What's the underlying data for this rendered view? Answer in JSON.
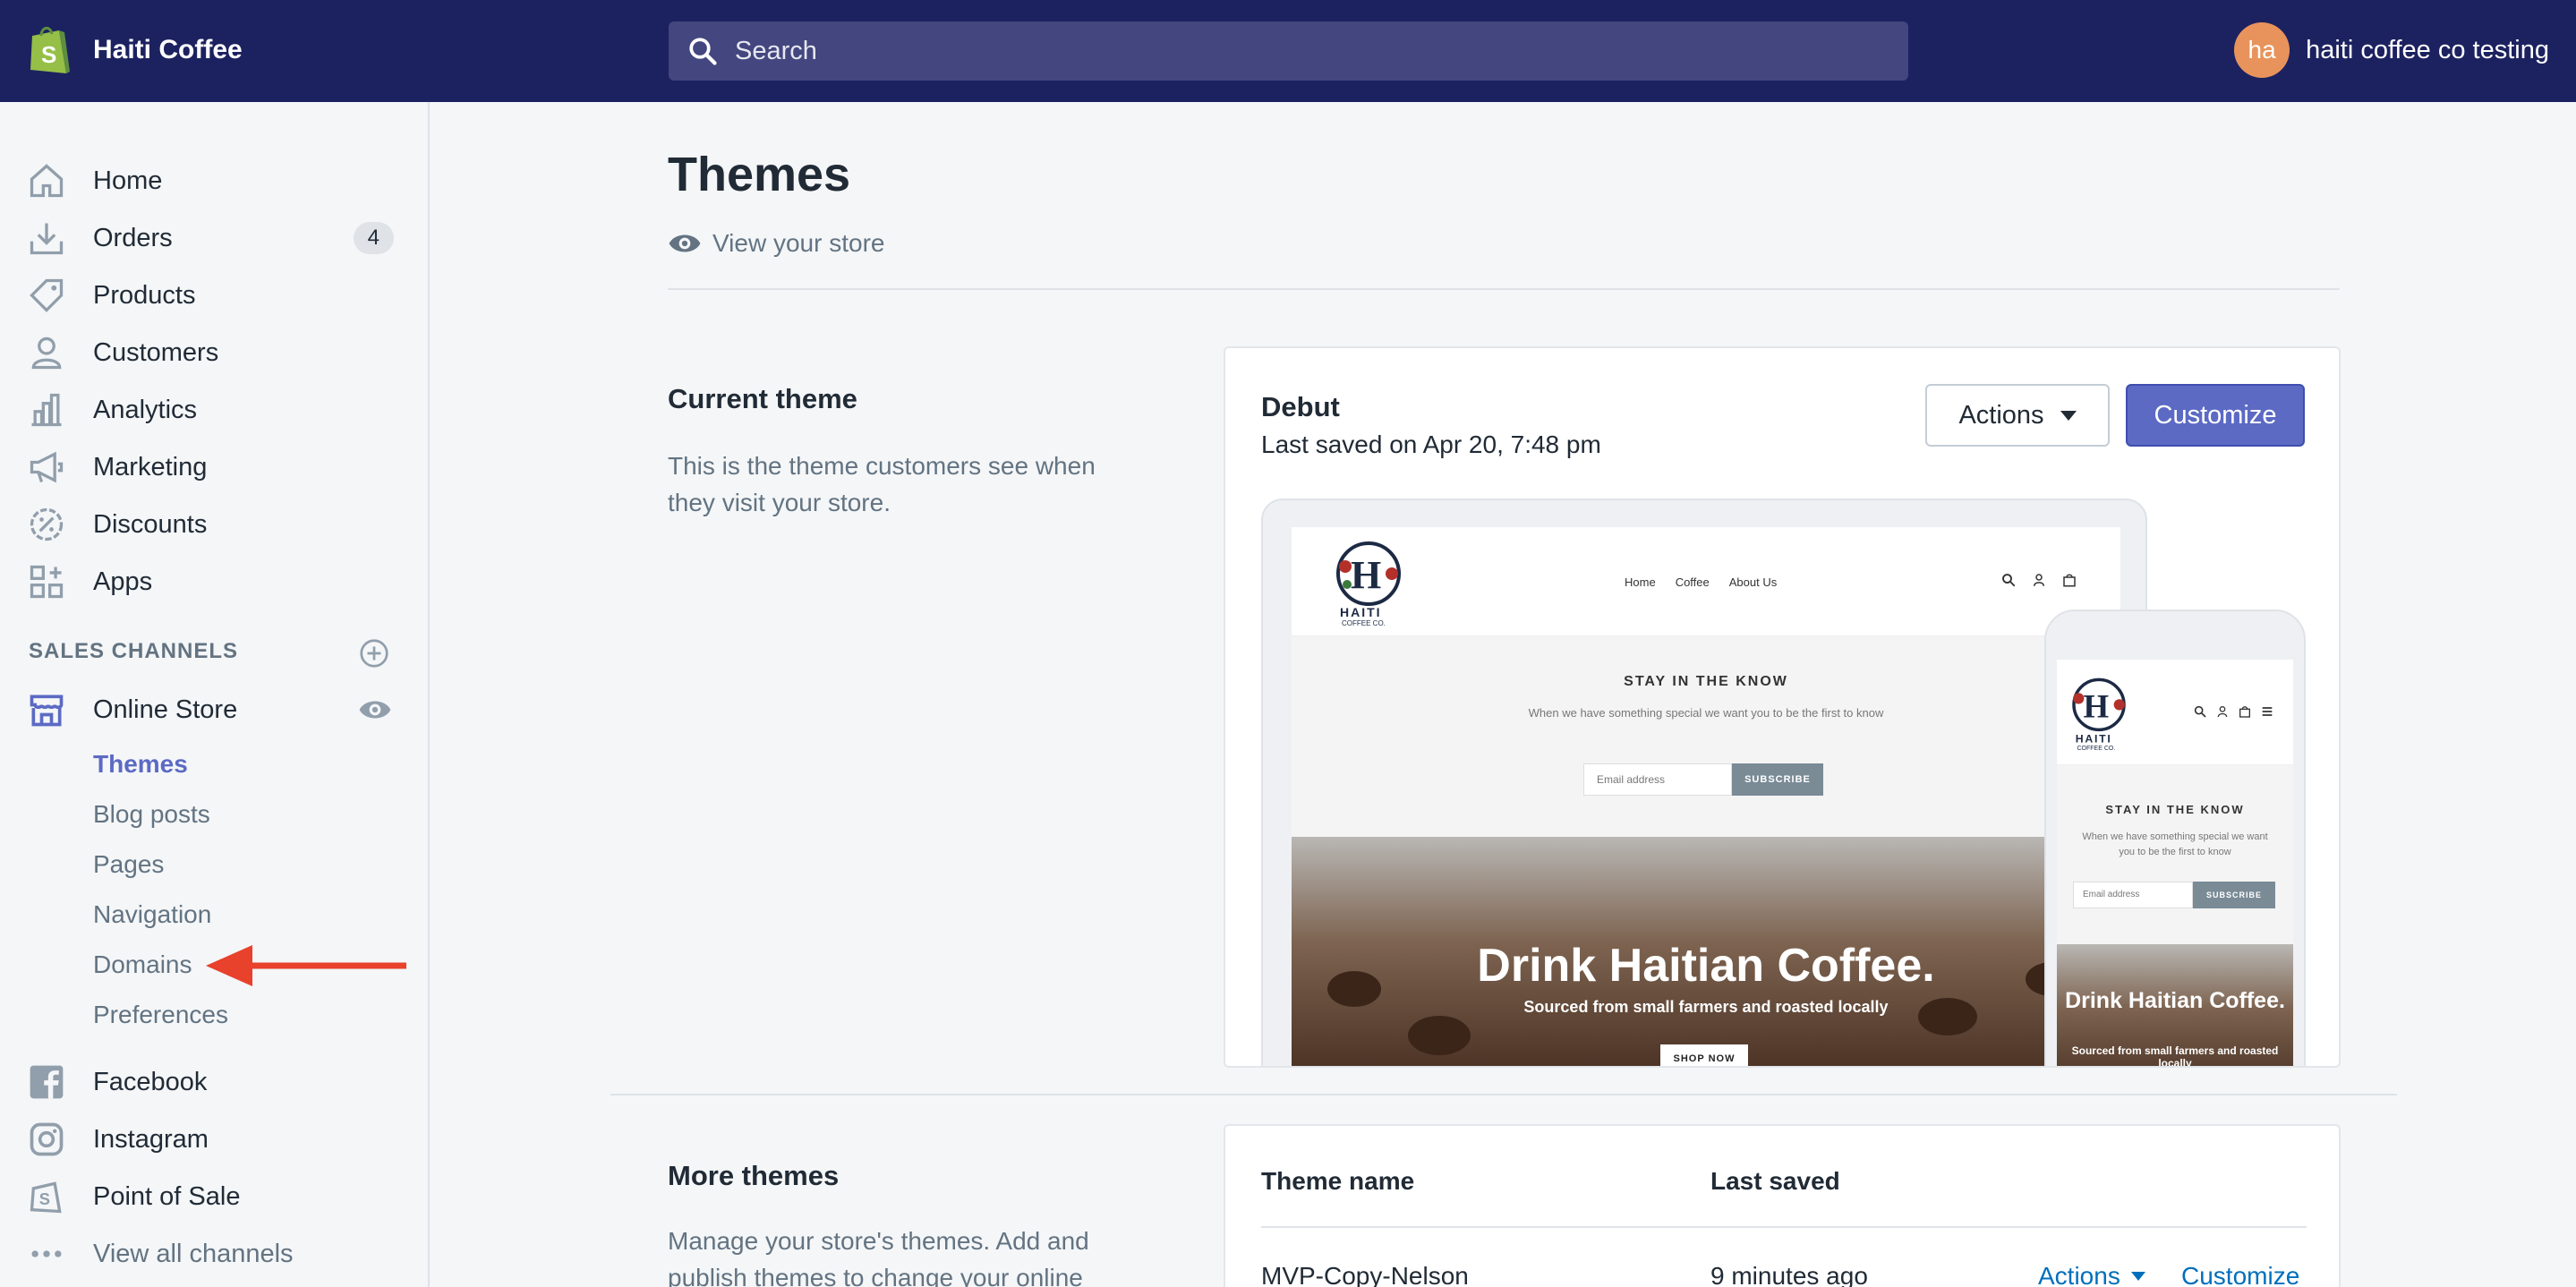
{
  "topbar": {
    "store_name": "Haiti Coffee",
    "search_placeholder": "Search",
    "avatar_initials": "ha",
    "account_name": "haiti coffee co testing"
  },
  "sidebar": {
    "items": [
      {
        "label": "Home",
        "icon": "home-icon"
      },
      {
        "label": "Orders",
        "icon": "orders-icon",
        "badge": "4"
      },
      {
        "label": "Products",
        "icon": "tag-icon"
      },
      {
        "label": "Customers",
        "icon": "person-icon"
      },
      {
        "label": "Analytics",
        "icon": "bar-chart-icon"
      },
      {
        "label": "Marketing",
        "icon": "megaphone-icon"
      },
      {
        "label": "Discounts",
        "icon": "discount-icon"
      },
      {
        "label": "Apps",
        "icon": "apps-icon"
      }
    ],
    "sales_channels_title": "SALES CHANNELS",
    "online_store": "Online Store",
    "online_store_subitems": [
      "Themes",
      "Blog posts",
      "Pages",
      "Navigation",
      "Domains",
      "Preferences"
    ],
    "active_subitem": "Themes",
    "channels": [
      {
        "label": "Facebook",
        "icon": "facebook-icon"
      },
      {
        "label": "Instagram",
        "icon": "instagram-icon"
      },
      {
        "label": "Point of Sale",
        "icon": "shopify-bag-icon"
      }
    ],
    "view_all": "View all channels"
  },
  "main": {
    "title": "Themes",
    "view_store": "View your store",
    "current_theme": {
      "heading": "Current theme",
      "description": "This is the theme customers see when they visit your store.",
      "name": "Debut",
      "last_saved": "Last saved on Apr 20, 7:48 pm",
      "actions_label": "Actions",
      "customize_label": "Customize"
    },
    "preview": {
      "nav": [
        "Home",
        "Coffee",
        "About Us"
      ],
      "logo_text": "HAITI",
      "logo_sub": "COFFEE CO.",
      "newsletter_title": "STAY IN THE KNOW",
      "newsletter_sub": "When we have something special we want you to be the first to know",
      "email_placeholder": "Email address",
      "subscribe": "SUBSCRIBE",
      "hero_title": "Drink Haitian Coffee.",
      "hero_sub": "Sourced from small farmers and roasted locally",
      "hero_button": "SHOP NOW"
    },
    "more_themes": {
      "heading": "More themes",
      "description": "Manage your store's themes. Add and publish themes to change your online",
      "columns": [
        "Theme name",
        "Last saved"
      ],
      "rows": [
        {
          "name": "MVP-Copy-Nelson",
          "saved": "9 minutes ago",
          "actions": "Actions",
          "customize": "Customize"
        }
      ]
    }
  },
  "colors": {
    "topbar": "#1c2260",
    "accent": "#5c6ac4",
    "link": "#006fbb",
    "arrow": "#e8412c"
  }
}
